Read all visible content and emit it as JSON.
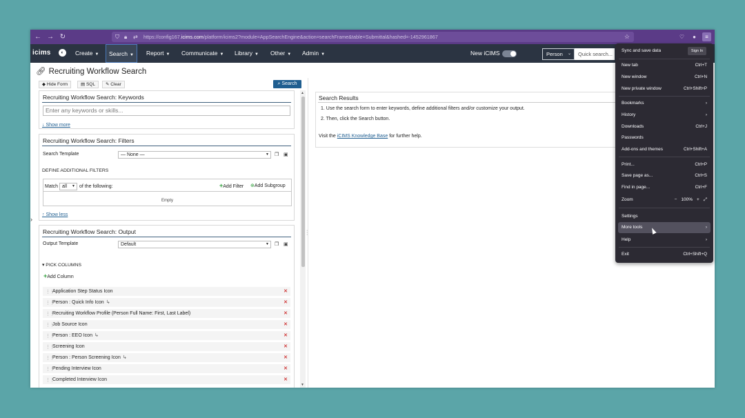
{
  "browser": {
    "url_prefix": "https://config167.",
    "url_host": "icims.com",
    "url_path": "/platform/icims2?module=AppSearchEngine&action=searchFrame&table=Submittal&hashed=-1452961867"
  },
  "app_nav": {
    "logo": "icims",
    "items": [
      "Create",
      "Search",
      "Report",
      "Communicate",
      "Library",
      "Other",
      "Admin"
    ],
    "new_icims_label": "New iCIMS",
    "person_select": "Person",
    "quick_search_placeholder": "Quick search..."
  },
  "page": {
    "title": "Recruiting Workflow Search",
    "toolbar": {
      "hide_form": "Hide Form",
      "sql": "SQL",
      "clear": "Clear",
      "search": "Search"
    }
  },
  "keywords": {
    "header": "Recruiting Workflow Search: Keywords",
    "placeholder": "Enter any keywords or skills...",
    "show_more": "↓ Show more"
  },
  "filters": {
    "header": "Recruiting Workflow Search: Filters",
    "search_template_label": "Search Template",
    "search_template_value": "— None —",
    "define_label": "DEFINE ADDITIONAL FILTERS",
    "match_prefix": "Match",
    "match_value": "all",
    "match_suffix": "of the following:",
    "add_filter": "Add Filter",
    "add_subgroup": "Add Subgroup",
    "empty": "Empty",
    "show_less": "↑ Show less"
  },
  "output": {
    "header": "Recruiting Workflow Search: Output",
    "output_template_label": "Output Template",
    "output_template_value": "Default",
    "pick_columns": "▾ PICK COLUMNS",
    "add_column": "Add Column",
    "columns": [
      "Application Step Status Icon",
      "Person : Quick Info Icon",
      "Recruiting Workflow Profile (Person Full Name: First, Last Label)",
      "Job Source Icon",
      "Person : EEO Icon",
      "Screening Icon",
      "Person : Person Screening Icon",
      "Pending Interview Icon",
      "Completed Interview Icon"
    ]
  },
  "results": {
    "header": "Search Results",
    "line1": "1. Use the search form to enter keywords, define additional filters and/or customize your output.",
    "line2": "2. Then, click the Search button.",
    "visit_prefix": "Visit the ",
    "kb_link": "iCIMS Knowledge Base",
    "visit_suffix": " for further help."
  },
  "ff_menu": {
    "sync": "Sync and save data",
    "sign_in": "Sign In",
    "items": [
      {
        "label": "New tab",
        "shortcut": "Ctrl+T"
      },
      {
        "label": "New window",
        "shortcut": "Ctrl+N"
      },
      {
        "label": "New private window",
        "shortcut": "Ctrl+Shift+P"
      },
      {
        "label": "Bookmarks",
        "shortcut": "›"
      },
      {
        "label": "History",
        "shortcut": "›"
      },
      {
        "label": "Downloads",
        "shortcut": "Ctrl+J"
      },
      {
        "label": "Passwords",
        "shortcut": ""
      },
      {
        "label": "Add-ons and themes",
        "shortcut": "Ctrl+Shift+A"
      },
      {
        "label": "Print...",
        "shortcut": "Ctrl+P"
      },
      {
        "label": "Save page as...",
        "shortcut": "Ctrl+S"
      },
      {
        "label": "Find in page...",
        "shortcut": "Ctrl+F"
      },
      {
        "label": "Zoom",
        "shortcut": ""
      },
      {
        "label": "Settings",
        "shortcut": ""
      },
      {
        "label": "More tools",
        "shortcut": "›"
      },
      {
        "label": "Help",
        "shortcut": "›"
      },
      {
        "label": "Exit",
        "shortcut": "Ctrl+Shift+Q"
      }
    ],
    "zoom_minus": "−",
    "zoom_value": "100%",
    "zoom_plus": "+",
    "zoom_full": "⤢"
  },
  "colors": {
    "browser_chrome": "#5b3b87",
    "app_nav": "#2b3442",
    "primary": "#1f5e90",
    "menu_bg": "#2c2a33"
  }
}
